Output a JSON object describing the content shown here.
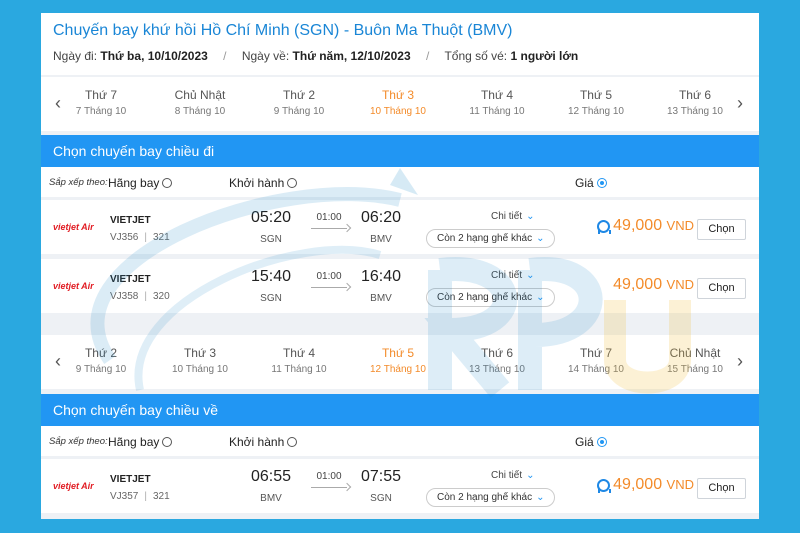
{
  "header": {
    "title": "Chuyến bay khứ hồi Hồ Chí Minh (SGN) - Buôn Ma Thuột (BMV)",
    "depart_label": "Ngày đi:",
    "depart_value": "Thứ ba, 10/10/2023",
    "return_label": "Ngày về:",
    "return_value": "Thứ năm, 12/10/2023",
    "tickets_label": "Tổng số vé:",
    "tickets_value": "1 người lớn",
    "separator": "/"
  },
  "outbound": {
    "dates": [
      {
        "dow": "Thứ 7",
        "dm": "7 Tháng 10"
      },
      {
        "dow": "Chủ Nhật",
        "dm": "8 Tháng 10"
      },
      {
        "dow": "Thứ 2",
        "dm": "9 Tháng 10"
      },
      {
        "dow": "Thứ 3",
        "dm": "10 Tháng 10",
        "active": true
      },
      {
        "dow": "Thứ 4",
        "dm": "11 Tháng 10"
      },
      {
        "dow": "Thứ 5",
        "dm": "12 Tháng 10"
      },
      {
        "dow": "Thứ 6",
        "dm": "13 Tháng 10"
      }
    ],
    "section_title": "Chọn chuyến bay chiều đi",
    "flights": [
      {
        "logo": "vietjet Air",
        "airline": "VIETJET",
        "code": "VJ356",
        "aircraft": "321",
        "dep_time": "05:20",
        "dep_airport": "SGN",
        "duration": "01:00",
        "arr_time": "06:20",
        "arr_airport": "BMV",
        "detail": "Chi tiết",
        "seats": "Còn 2 hạng ghế khác",
        "price": "49,000",
        "currency": "VND",
        "choose": "Chọn",
        "award_icon": true
      },
      {
        "logo": "vietjet Air",
        "airline": "VIETJET",
        "code": "VJ358",
        "aircraft": "320",
        "dep_time": "15:40",
        "dep_airport": "SGN",
        "duration": "01:00",
        "arr_time": "16:40",
        "arr_airport": "BMV",
        "detail": "Chi tiết",
        "seats": "Còn 2 hạng ghế khác",
        "price": "49,000",
        "currency": "VND",
        "choose": "Chọn",
        "award_icon": false
      }
    ]
  },
  "return": {
    "dates": [
      {
        "dow": "Thứ 2",
        "dm": "9 Tháng 10"
      },
      {
        "dow": "Thứ 3",
        "dm": "10 Tháng 10"
      },
      {
        "dow": "Thứ 4",
        "dm": "11 Tháng 10"
      },
      {
        "dow": "Thứ 5",
        "dm": "12 Tháng 10",
        "active": true
      },
      {
        "dow": "Thứ 6",
        "dm": "13 Tháng 10"
      },
      {
        "dow": "Thứ 7",
        "dm": "14 Tháng 10"
      },
      {
        "dow": "Chủ Nhật",
        "dm": "15 Tháng 10"
      }
    ],
    "section_title": "Chọn chuyến bay chiều về",
    "flights": [
      {
        "logo": "vietjet Air",
        "airline": "VIETJET",
        "code": "VJ357",
        "aircraft": "321",
        "dep_time": "06:55",
        "dep_airport": "BMV",
        "duration": "01:00",
        "arr_time": "07:55",
        "arr_airport": "SGN",
        "detail": "Chi tiết",
        "seats": "Còn 2 hạng ghế khác",
        "price": "49,000",
        "currency": "VND",
        "choose": "Chọn",
        "award_icon": true
      }
    ]
  },
  "sort": {
    "label": "Sắp xếp theo:",
    "airline": "Hãng bay",
    "departure": "Khởi hành",
    "price": "Giá",
    "selected": "price"
  },
  "icons": {
    "prev": "chevron-left-icon",
    "next": "chevron-right-icon",
    "dropdown": "chevron-down-icon",
    "award": "award-icon",
    "route": "arrow-right-icon"
  },
  "colors": {
    "background": "#2aa8e0",
    "accent_blue": "#2196f3",
    "title_blue": "#1a86d6",
    "price_orange": "#f38b2a",
    "brand_red": "#e11b22"
  }
}
